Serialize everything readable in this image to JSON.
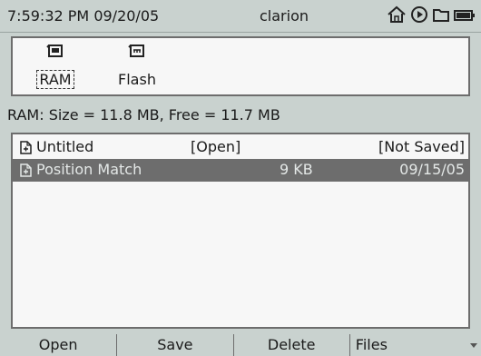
{
  "status": {
    "time": "7:59:32 PM",
    "date": "09/20/05",
    "device": "clarion",
    "icons": [
      "home-icon",
      "play-icon",
      "folder-icon",
      "battery-icon"
    ]
  },
  "drives": [
    {
      "label": "RAM",
      "icon": "memory-card-icon",
      "selected": true
    },
    {
      "label": "Flash",
      "icon": "flash-card-icon",
      "selected": false
    }
  ],
  "memory_info": "RAM: Size = 11.8 MB, Free = 11.7 MB",
  "files": [
    {
      "name": "Untitled",
      "size": "[Open]",
      "date": "[Not Saved]",
      "selected": false
    },
    {
      "name": "Position Match",
      "size": "9 KB",
      "date": "09/15/05",
      "selected": true
    }
  ],
  "softkeys": {
    "open": "Open",
    "save": "Save",
    "delete": "Delete",
    "files": "Files"
  }
}
